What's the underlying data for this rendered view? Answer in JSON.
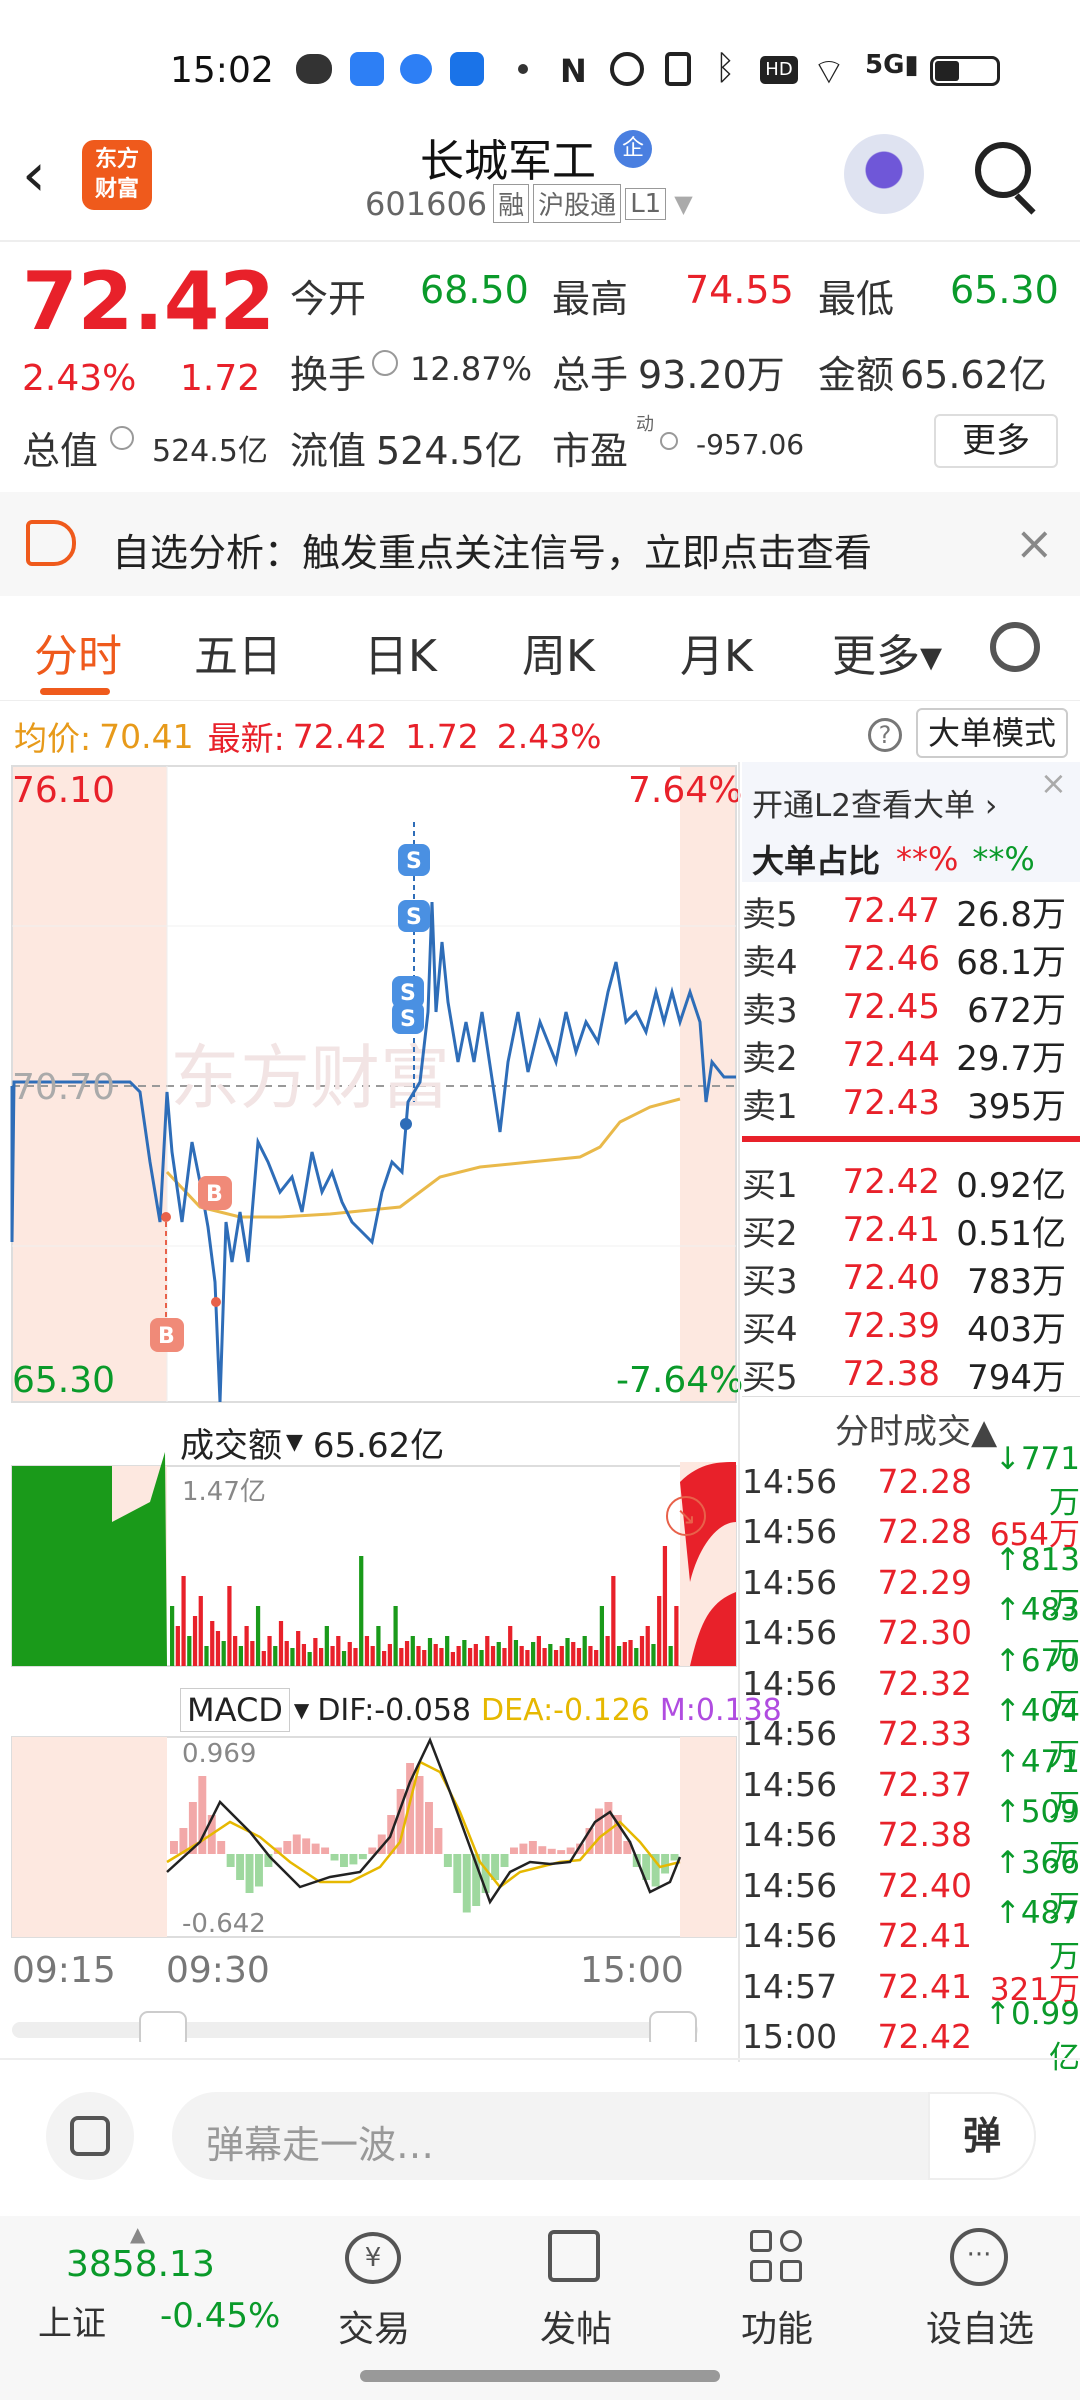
{
  "status": {
    "time": "15:02"
  },
  "header": {
    "title": "长城军工",
    "badge": "企",
    "code": "601606",
    "tag1": "融",
    "tag2": "沪股通",
    "tag3": "L1",
    "logo": "东方\n财富"
  },
  "quote": {
    "price": "72.42",
    "pct": "2.43%",
    "change": "1.72",
    "open_label": "今开",
    "open": "68.50",
    "high_label": "最高",
    "high": "74.55",
    "low_label": "最低",
    "low": "65.30",
    "turnover_label": "换手",
    "turnover": "12.87%",
    "volume_label": "总手",
    "volume": "93.20万",
    "amount_label": "金额",
    "amount": "65.62亿",
    "total_cap_label": "总值",
    "total_cap": "524.5亿",
    "float_cap_label": "流值",
    "float_cap": "524.5亿",
    "pe_label": "市盈",
    "pe_sup": "动",
    "pe": "-957.06",
    "more": "更多"
  },
  "notice": {
    "text": "自选分析：触发重点关注信号，立即点击查看"
  },
  "tabs": [
    "分时",
    "五日",
    "日K",
    "周K",
    "月K",
    "更多▾"
  ],
  "infobar": {
    "avg_label": "均价:",
    "avg": "70.41",
    "latest_label": "最新:",
    "latest": "72.42",
    "change": "1.72",
    "pct": "2.43%",
    "mode_button": "大单模式"
  },
  "chart_labels": {
    "ymax": "76.10",
    "ymid": "70.70",
    "ymin": "65.30",
    "pct_top": "7.64%",
    "pct_bottom": "-7.64%",
    "watermark": "东方财富"
  },
  "volume_panel": {
    "label": "成交额",
    "value": "65.62亿",
    "max": "1.47亿"
  },
  "macd_panel": {
    "label": "MACD",
    "dif": "DIF:-0.058",
    "dea": "DEA:-0.126",
    "m": "M:0.138",
    "max": "0.969",
    "min": "-0.642"
  },
  "time_axis": {
    "t1": "09:15",
    "t2": "09:30",
    "t3": "15:00"
  },
  "l2": {
    "link": "开通L2查看大单 ›",
    "big_ratio_label": "大单占比",
    "big_ratio_red": "**%",
    "big_ratio_green": "**%"
  },
  "orderbook": {
    "sells": [
      {
        "label": "卖5",
        "price": "72.47",
        "vol": "26.8万"
      },
      {
        "label": "卖4",
        "price": "72.46",
        "vol": "68.1万"
      },
      {
        "label": "卖3",
        "price": "72.45",
        "vol": "672万"
      },
      {
        "label": "卖2",
        "price": "72.44",
        "vol": "29.7万"
      },
      {
        "label": "卖1",
        "price": "72.43",
        "vol": "395万"
      }
    ],
    "buys": [
      {
        "label": "买1",
        "price": "72.42",
        "vol": "0.92亿"
      },
      {
        "label": "买2",
        "price": "72.41",
        "vol": "0.51亿"
      },
      {
        "label": "买3",
        "price": "72.40",
        "vol": "783万"
      },
      {
        "label": "买4",
        "price": "72.39",
        "vol": "403万"
      },
      {
        "label": "买5",
        "price": "72.38",
        "vol": "794万"
      }
    ]
  },
  "trades_header": "分时成交▲",
  "trades": [
    {
      "time": "14:56",
      "price": "72.28",
      "vol": "↓771万",
      "dir": "down"
    },
    {
      "time": "14:56",
      "price": "72.28",
      "vol": "654万",
      "dir": "none"
    },
    {
      "time": "14:56",
      "price": "72.29",
      "vol": "↑813万",
      "dir": "up"
    },
    {
      "time": "14:56",
      "price": "72.30",
      "vol": "↑483万",
      "dir": "up"
    },
    {
      "time": "14:56",
      "price": "72.32",
      "vol": "↑670万",
      "dir": "up"
    },
    {
      "time": "14:56",
      "price": "72.33",
      "vol": "↑404万",
      "dir": "up"
    },
    {
      "time": "14:56",
      "price": "72.37",
      "vol": "↑471万",
      "dir": "up"
    },
    {
      "time": "14:56",
      "price": "72.38",
      "vol": "↑509万",
      "dir": "up"
    },
    {
      "time": "14:56",
      "price": "72.40",
      "vol": "↑366万",
      "dir": "up"
    },
    {
      "time": "14:56",
      "price": "72.41",
      "vol": "↑487万",
      "dir": "up"
    },
    {
      "time": "14:57",
      "price": "72.41",
      "vol": "321万",
      "dir": "none"
    },
    {
      "time": "15:00",
      "price": "72.42",
      "vol": "↑0.99亿",
      "dir": "up"
    }
  ],
  "comment": {
    "placeholder": "弹幕走一波…",
    "danmu": "弹"
  },
  "bottom_nav": {
    "index_value": "3858.13",
    "index_name": "上证",
    "index_pct": "-0.45%",
    "trade": "交易",
    "post": "发帖",
    "func": "功能",
    "watch": "设自选"
  },
  "colors": {
    "up": "#e8212a",
    "down": "#0a9a2a",
    "accent": "#ef5a1c",
    "avg_line": "#e9b94a",
    "price_line": "#2e6db8"
  }
}
